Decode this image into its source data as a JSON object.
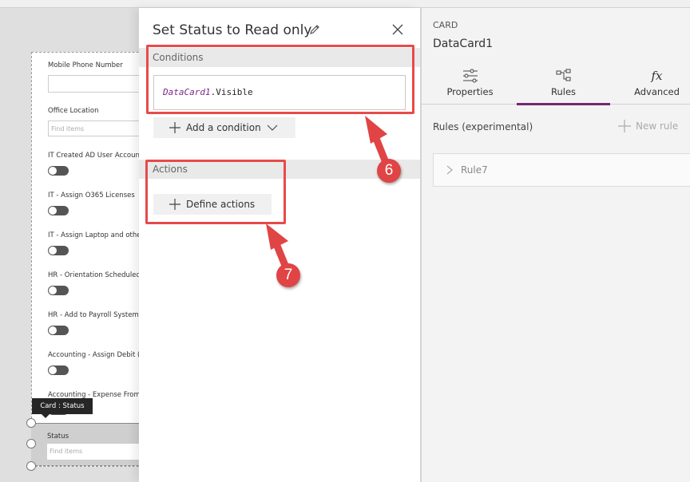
{
  "canvas": {
    "fields": [
      {
        "label": "Mobile Phone Number",
        "type": "text",
        "value": ""
      },
      {
        "label": "Office Location",
        "type": "combo",
        "placeholder": "Find items"
      },
      {
        "label": "IT Created AD User Accoun",
        "type": "toggle",
        "on": false
      },
      {
        "label": "IT - Assign O365 Licenses",
        "type": "toggle",
        "on": false
      },
      {
        "label": "IT - Assign Laptop and othe",
        "type": "toggle",
        "on": false
      },
      {
        "label": "HR - Orientation Scheduled",
        "type": "toggle",
        "on": false
      },
      {
        "label": "HR - Add to Payroll System",
        "type": "toggle",
        "on": false
      },
      {
        "label": "Accounting - Assign Debit (",
        "type": "toggle",
        "on": false
      },
      {
        "label": "Accounting - Expense From",
        "type": "toggle",
        "on": false
      }
    ],
    "selected_card": {
      "tooltip": "Card : Status",
      "label": "Status",
      "placeholder": "Find items"
    }
  },
  "rule_panel": {
    "title": "Set Status to Read only",
    "conditions_header": "Conditions",
    "condition": {
      "identifier": "DataCard1",
      "property": ".Visible"
    },
    "add_condition_label": "Add a condition",
    "actions_header": "Actions",
    "define_actions_label": "Define actions"
  },
  "inspector": {
    "kind": "CARD",
    "name": "DataCard1",
    "tabs": [
      {
        "label": "Properties",
        "icon": "sliders-icon",
        "active": false
      },
      {
        "label": "Rules",
        "icon": "rules-flow-icon",
        "active": true
      },
      {
        "label": "Advanced",
        "icon": "fx-icon",
        "active": false
      }
    ],
    "rules_header": "Rules (experimental)",
    "new_rule_label": "New rule",
    "rules": [
      {
        "name": "Rule7"
      }
    ],
    "accent_color": "#742774"
  },
  "annotations": [
    {
      "number": "6",
      "target": "conditions-section"
    },
    {
      "number": "7",
      "target": "actions-section"
    }
  ]
}
